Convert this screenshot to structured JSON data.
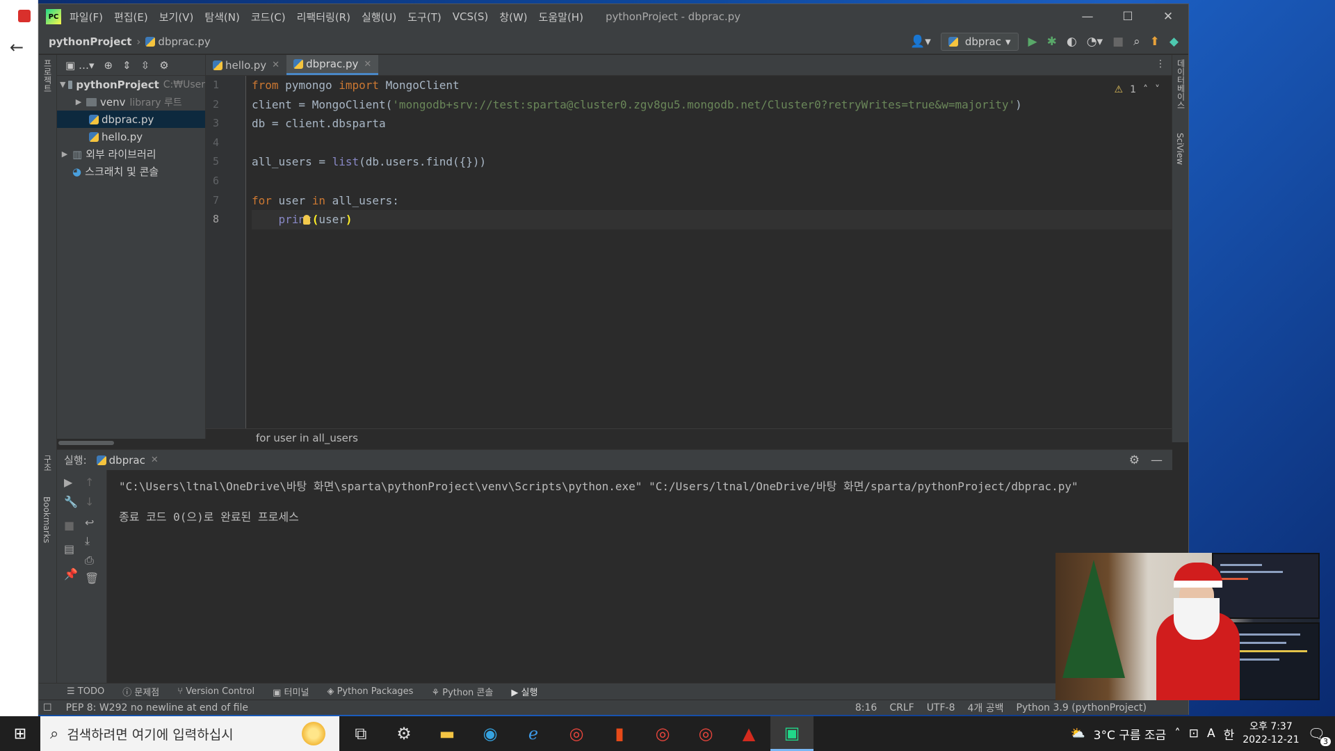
{
  "window": {
    "title": "pythonProject - dbprac.py",
    "menu": [
      "파일(F)",
      "편집(E)",
      "보기(V)",
      "탐색(N)",
      "코드(C)",
      "리팩터링(R)",
      "실행(U)",
      "도구(T)",
      "VCS(S)",
      "창(W)",
      "도움말(H)"
    ]
  },
  "navbar": {
    "project": "pythonProject",
    "file": "dbprac.py",
    "run_config": "dbprac"
  },
  "left_strip": {
    "project_label": "프로젝트",
    "structure_label": "구조",
    "bookmarks_label": "Bookmarks"
  },
  "right_strip": {
    "database_label": "데이터베이스",
    "sciview_label": "SciView"
  },
  "project_tree": {
    "root": "pythonProject",
    "root_path": "C:₩User",
    "items": [
      {
        "name": "venv",
        "hint": "library 루트",
        "type": "folder"
      },
      {
        "name": "dbprac.py",
        "type": "python",
        "selected": true
      },
      {
        "name": "hello.py",
        "type": "python"
      }
    ],
    "external_libs": "외부 라이브러리",
    "scratches": "스크래치 및 콘솔"
  },
  "tabs": [
    {
      "label": "hello.py",
      "active": false
    },
    {
      "label": "dbprac.py",
      "active": true
    }
  ],
  "editor": {
    "line_numbers": [
      "1",
      "2",
      "3",
      "4",
      "5",
      "6",
      "7",
      "8"
    ],
    "current_line": 8,
    "code": {
      "l1_kw1": "from",
      "l1_mod": " pymongo ",
      "l1_kw2": "import",
      "l1_name": " MongoClient",
      "l2_pre": "client = MongoClient(",
      "l2_str": "'mongodb+srv://test:sparta@cluster0.zgv8gu5.mongodb.net/Cluster0?retryWrites=true&w=majority'",
      "l2_post": ")",
      "l3": "db = client.dbsparta",
      "l5_pre": "all_users = ",
      "l5_fn": "list",
      "l5_post": "(db.users.find({}))",
      "l7_kw1": "for",
      "l7_mid": " user ",
      "l7_kw2": "in",
      "l7_post": " all_users:",
      "l8_indent": "    ",
      "l8_fn": "print",
      "l8_open": "(",
      "l8_arg": "user",
      "l8_close": ")"
    },
    "warnings_count": "1",
    "breadcrumb": "for user in all_users"
  },
  "run_panel": {
    "label": "실행:",
    "tab": "dbprac",
    "command": "\"C:\\Users\\ltnal\\OneDrive\\바탕 화면\\sparta\\pythonProject\\venv\\Scripts\\python.exe\" \"C:/Users/ltnal/OneDrive/바탕 화면/sparta/pythonProject/dbprac.py\"",
    "exit_message": "종료 코드 0(으)로 완료된 프로세스"
  },
  "bottom_tools": [
    "TODO",
    "문제점",
    "Version Control",
    "터미널",
    "Python Packages",
    "Python 콘솔",
    "실행"
  ],
  "status": {
    "message": "PEP 8: W292 no newline at end of file",
    "position": "8:16",
    "line_sep": "CRLF",
    "encoding": "UTF-8",
    "indent": "4개 공백",
    "interpreter": "Python 3.9 (pythonProject)"
  },
  "taskbar": {
    "search_placeholder": "검색하려면 여기에 입력하십시",
    "weather": "3°C 구름 조금",
    "ime": "한",
    "ime_a": "A",
    "time": "오후 7:37",
    "date": "2022-12-21",
    "notifications": "3"
  },
  "colors": {
    "accent": "#4a88c7",
    "keyword": "#cc7832",
    "string": "#6a8759",
    "builtin": "#8888c6"
  }
}
